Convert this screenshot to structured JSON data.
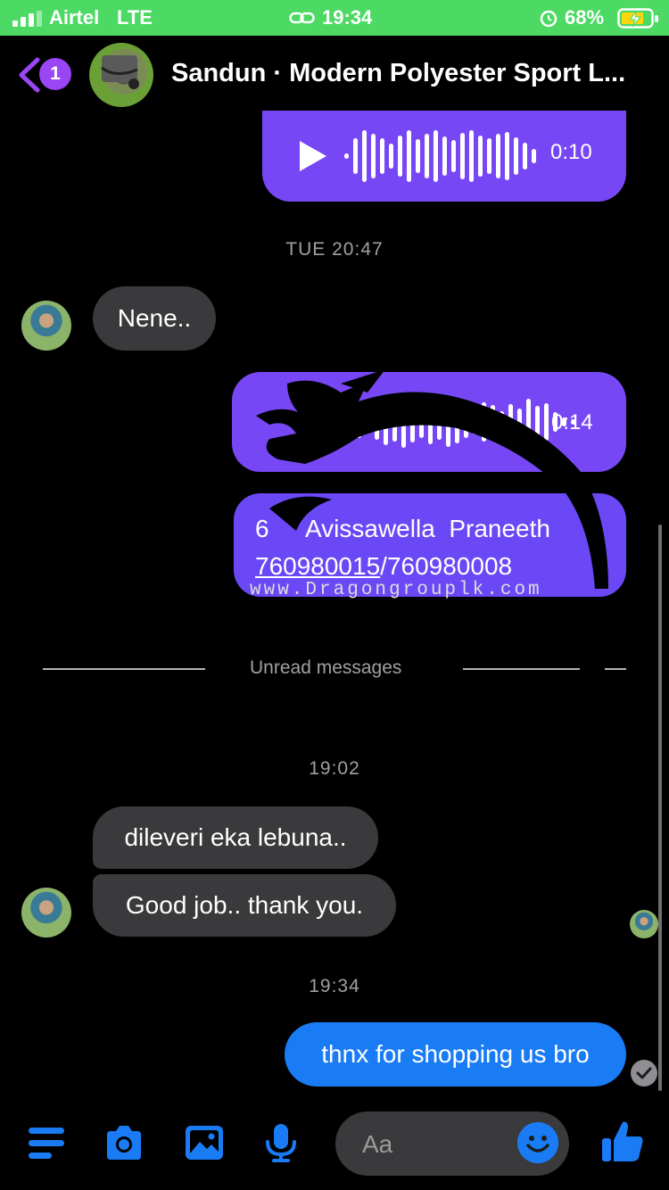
{
  "status_bar": {
    "carrier": "Airtel",
    "network": "LTE",
    "time": "19:34",
    "battery": "68%"
  },
  "header": {
    "unread_count": "1",
    "title": "Sandun · Modern Polyester Sport L..."
  },
  "messages": {
    "voice1_duration": "0:10",
    "timestamp1": "TUE 20:47",
    "incoming1": "Nene..",
    "voice2_duration": "0:14",
    "contact_index": "6",
    "contact_name": "Avissawella  Praneeth",
    "contact_phone1": "760980015",
    "contact_phone_sep": "/",
    "contact_phone2": "760980008",
    "watermark": "www.Dragongrouplk.com",
    "unread_divider": "Unread messages",
    "timestamp2": "19:02",
    "incoming2": "dileveri eka lebuna..",
    "incoming3": "Good job.. thank you.",
    "timestamp3": "19:34",
    "outgoing1": "thnx for shopping us bro"
  },
  "composer": {
    "placeholder": "Aa"
  },
  "colors": {
    "accent_purple": "#7847f5",
    "messenger_blue": "#1a7cf5",
    "status_green": "#4cd964"
  },
  "icons": [
    "menu-icon",
    "camera-icon",
    "image-icon",
    "microphone-icon",
    "emoji-icon",
    "thumbs-up-icon"
  ]
}
